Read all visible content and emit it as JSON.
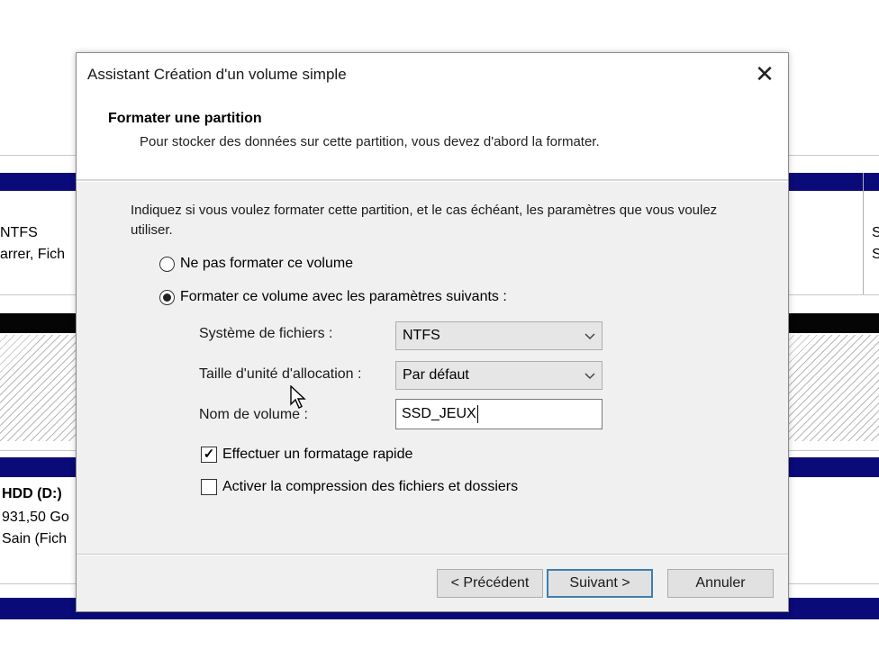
{
  "background": {
    "partition_fs": "NTFS",
    "partition_status": "arrer, Fich",
    "disk_name": "HDD  (D:)",
    "disk_size": "931,50 Go",
    "disk_status": "Sain (Fich",
    "right_col_1": "S",
    "right_col_2": "S"
  },
  "dialog": {
    "title": "Assistant Création d'un volume simple",
    "close_glyph": "✕",
    "header_title": "Formater une partition",
    "header_subtitle": "Pour stocker des données sur cette partition, vous devez d'abord la formater.",
    "intro": "Indiquez si vous voulez formater cette partition, et le cas échéant, les paramètres que vous voulez utiliser.",
    "options": {
      "no_format_label": "Ne pas formater ce volume",
      "no_format_selected": false,
      "format_label": "Formater ce volume avec les paramètres suivants :",
      "format_selected": true
    },
    "fields": {
      "filesystem_label": "Système de fichiers :",
      "filesystem_value": "NTFS",
      "allocation_label": "Taille d'unité d'allocation :",
      "allocation_value": "Par défaut",
      "volume_name_label": "Nom de volume :",
      "volume_name_value": "SSD_JEUX"
    },
    "checkboxes": {
      "quick_format_label": "Effectuer un formatage rapide",
      "quick_format_checked": true,
      "compression_label": "Activer la compression des fichiers et dossiers",
      "compression_checked": false
    },
    "buttons": {
      "back": "< Précédent",
      "next": "Suivant >",
      "cancel": "Annuler"
    }
  },
  "icons": {
    "dropdown": "chevron-down-icon",
    "check": "✓"
  }
}
